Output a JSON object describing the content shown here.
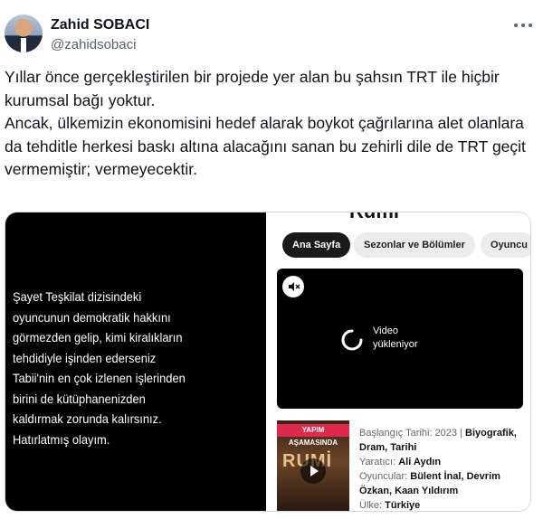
{
  "author": {
    "name": "Zahid SOBACI",
    "handle": "@zahidsobaci"
  },
  "tweet": {
    "paragraph1": "Yıllar önce gerçekleştirilen bir projede yer alan bu şahsın TRT ile hiçbir kurumsal bağı yoktur.",
    "paragraph2": "Ancak, ülkemizin ekonomisini hedef alarak boykot çağrılarına alet olanlara da tehditle herkesi baskı altına alacağını sanan bu zehirli dile de TRT geçit vermemiştir; vermeyecektir."
  },
  "media": {
    "quote_lines": [
      "Şayet Teşkilat dizisindeki",
      "oyuncunun demokratik hakkını",
      "görmezden gelip, kimi kiralıkların",
      "tehdidiyle işinden ederseniz",
      "Tabii'nin en çok izlenen işlerinden",
      "birini de kütüphanenizden",
      "kaldırmak zorunda kalırsınız.",
      "Hatırlatmış olayım."
    ],
    "site_title": "Rumi",
    "tabs": [
      "Ana Sayfa",
      "Sezonlar ve Bölümler",
      "Oyuncu"
    ],
    "video_loading_line1": "Video",
    "video_loading_line2": "yükleniyor",
    "poster_badge": "YAPIM AŞAMASINDA",
    "poster_title": "RUMİ",
    "info": {
      "start_label": "Başlangıç Tarihi: 2023 |",
      "genres_1": "Biyografik,",
      "genres_2": "Dram, Tarihi",
      "creator_label": "Yaratıcı:",
      "creator": "Ali Aydın",
      "cast_label": "Oyuncular:",
      "cast_1": "Bülent İnal, Devrim",
      "cast_2": "Özkan, Kaan Yıldırım",
      "country_label": "Ülke:",
      "country": "Türkiye"
    }
  },
  "icons": {
    "more": "more-horizontal-icon",
    "mute": "volume-mute-icon",
    "spinner": "loading-spinner-icon",
    "play": "play-icon"
  }
}
